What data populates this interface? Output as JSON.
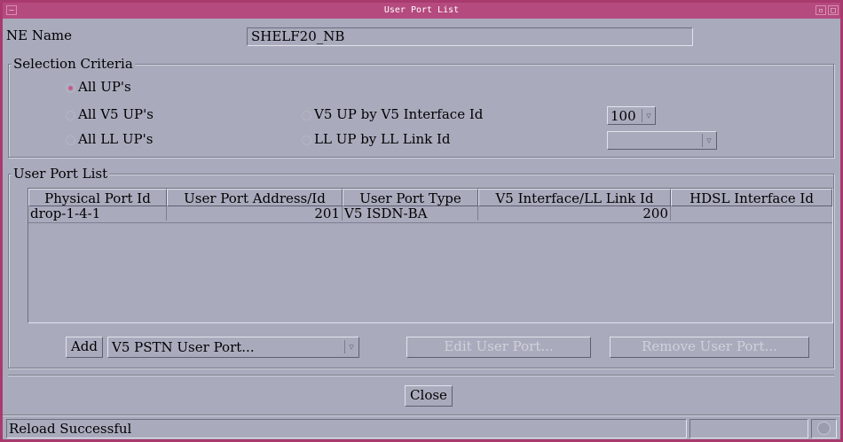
{
  "window": {
    "title": "User Port List"
  },
  "ne": {
    "label": "NE Name",
    "value": "SHELF20_NB"
  },
  "selection": {
    "title": "Selection Criteria",
    "all_ups": "All UP's",
    "all_v5_ups": "All V5 UP's",
    "all_ll_ups": "All LL UP's",
    "v5_by_interface": "V5 UP by V5 Interface Id",
    "ll_by_link": "LL UP by LL Link Id",
    "v5_interface_value": "100",
    "ll_link_value": "",
    "selected": "all_ups"
  },
  "list": {
    "title": "User Port List",
    "columns": [
      "Physical Port Id",
      "User Port Address/Id",
      "User Port Type",
      "V5 Interface/LL Link Id",
      "HDSL Interface Id"
    ],
    "rows": [
      {
        "physical_port_id": "drop-1-4-1",
        "user_port_address": "201",
        "user_port_type": "V5 ISDN-BA",
        "v5_interface_link": "200",
        "hdsl_interface": ""
      }
    ]
  },
  "actions": {
    "add_label": "Add",
    "add_type": "V5 PSTN User Port...",
    "edit_label": "Edit User Port...",
    "remove_label": "Remove User Port...",
    "close_label": "Close"
  },
  "status": {
    "message": "Reload Successful"
  },
  "colors": {
    "frame": "#a93a6e",
    "titlebar": "#b54a7e",
    "background": "#a9abbd",
    "radio_on": "#c65a8a"
  }
}
